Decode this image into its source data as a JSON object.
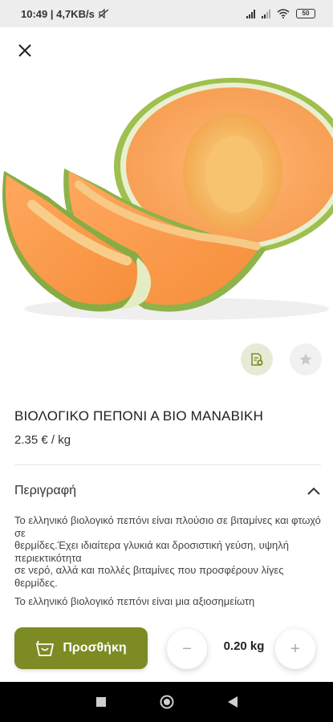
{
  "status_bar": {
    "time_speed": "10:49 | 4,7KB/s",
    "battery": "50"
  },
  "icons": {
    "close": "close-icon",
    "list": "list-add-icon",
    "favorite": "star-icon",
    "expand": "chevron-up-icon",
    "bag": "shopping-bag-icon"
  },
  "product": {
    "title": "ΒΙΟΛΟΓΙΚΟ ΠΕΠΟΝΙ Α ΒΙΟ ΜΑΝΑΒΙΚΗ",
    "price": "2.35 € / kg"
  },
  "description": {
    "header": "Περιγραφή",
    "paragraph1": "Το ελληνικό βιολογικό πεπόνι είναι πλούσιο σε βιταμίνες και φτωχό σε\nθερμίδες.Έχει ιδιαίτερα γλυκιά και δροσιστική γεύση, υψηλή περιεκτικότητα\nσε νερό, αλλά και πολλές βιταμίνες που προσφέρουν λίγες θερμίδες.",
    "paragraph2": "Το ελληνικό βιολογικό πεπόνι είναι μια αξιοσημείωτη"
  },
  "cart": {
    "add_label": "Προσθήκη",
    "quantity": "0.20 kg",
    "minus": "−",
    "plus": "+"
  },
  "colors": {
    "accent": "#7c8b23",
    "list_button_bg": "#e7ebd6"
  }
}
